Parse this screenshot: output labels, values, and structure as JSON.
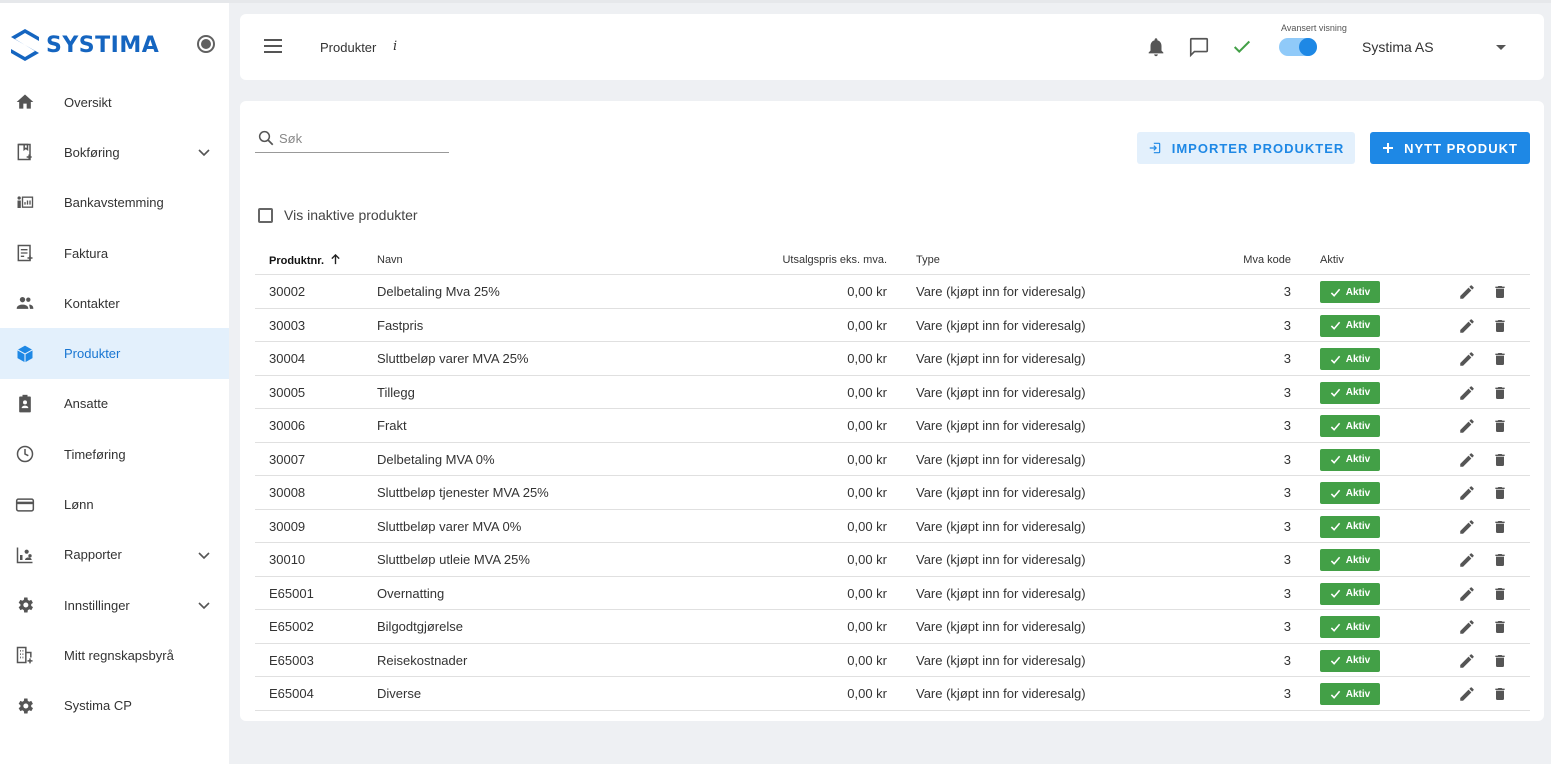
{
  "app": {
    "logo_text": "SYSTIMA"
  },
  "sidebar": {
    "items": [
      {
        "label": "Oversikt",
        "icon": "home-icon"
      },
      {
        "label": "Bokføring",
        "icon": "bookkeeping-icon",
        "expandable": true
      },
      {
        "label": "Bankavstemming",
        "icon": "bank-reconciliation-icon"
      },
      {
        "label": "Faktura",
        "icon": "invoice-icon"
      },
      {
        "label": "Kontakter",
        "icon": "contacts-icon"
      },
      {
        "label": "Produkter",
        "icon": "product-box-icon",
        "active": true
      },
      {
        "label": "Ansatte",
        "icon": "employee-badge-icon"
      },
      {
        "label": "Timeføring",
        "icon": "clock-icon"
      },
      {
        "label": "Lønn",
        "icon": "credit-card-icon"
      },
      {
        "label": "Rapporter",
        "icon": "reports-icon",
        "expandable": true
      },
      {
        "label": "Innstillinger",
        "icon": "settings-gear-icon",
        "expandable": true
      },
      {
        "label": "Mitt regnskapsbyrå",
        "icon": "office-building-icon"
      },
      {
        "label": "Systima CP",
        "icon": "settings-gear-icon"
      }
    ]
  },
  "header": {
    "breadcrumb": "Produkter",
    "info": "i",
    "advanced_view_label": "Avansert visning",
    "advanced_view_on": true,
    "company": "Systima AS"
  },
  "toolbar": {
    "search_placeholder": "Søk",
    "import_label": "IMPORTER PRODUKTER",
    "new_label": "NYTT PRODUKT",
    "show_inactive_label": "Vis inaktive produkter"
  },
  "table": {
    "columns": {
      "nr": "Produktnr.",
      "navn": "Navn",
      "pris": "Utsalgspris eks. mva.",
      "type": "Type",
      "mva": "Mva kode",
      "aktiv": "Aktiv"
    },
    "rows": [
      {
        "nr": "30002",
        "navn": "Delbetaling Mva 25%",
        "pris": "0,00 kr",
        "type": "Vare (kjøpt inn for videresalg)",
        "mva": "3",
        "aktiv": "Aktiv"
      },
      {
        "nr": "30003",
        "navn": "Fastpris",
        "pris": "0,00 kr",
        "type": "Vare (kjøpt inn for videresalg)",
        "mva": "3",
        "aktiv": "Aktiv"
      },
      {
        "nr": "30004",
        "navn": "Sluttbeløp varer MVA 25%",
        "pris": "0,00 kr",
        "type": "Vare (kjøpt inn for videresalg)",
        "mva": "3",
        "aktiv": "Aktiv"
      },
      {
        "nr": "30005",
        "navn": "Tillegg",
        "pris": "0,00 kr",
        "type": "Vare (kjøpt inn for videresalg)",
        "mva": "3",
        "aktiv": "Aktiv"
      },
      {
        "nr": "30006",
        "navn": "Frakt",
        "pris": "0,00 kr",
        "type": "Vare (kjøpt inn for videresalg)",
        "mva": "3",
        "aktiv": "Aktiv"
      },
      {
        "nr": "30007",
        "navn": "Delbetaling MVA 0%",
        "pris": "0,00 kr",
        "type": "Vare (kjøpt inn for videresalg)",
        "mva": "3",
        "aktiv": "Aktiv"
      },
      {
        "nr": "30008",
        "navn": "Sluttbeløp tjenester MVA 25%",
        "pris": "0,00 kr",
        "type": "Vare (kjøpt inn for videresalg)",
        "mva": "3",
        "aktiv": "Aktiv"
      },
      {
        "nr": "30009",
        "navn": "Sluttbeløp varer MVA 0%",
        "pris": "0,00 kr",
        "type": "Vare (kjøpt inn for videresalg)",
        "mva": "3",
        "aktiv": "Aktiv"
      },
      {
        "nr": "30010",
        "navn": "Sluttbeløp utleie MVA 25%",
        "pris": "0,00 kr",
        "type": "Vare (kjøpt inn for videresalg)",
        "mva": "3",
        "aktiv": "Aktiv"
      },
      {
        "nr": "E65001",
        "navn": "Overnatting",
        "pris": "0,00 kr",
        "type": "Vare (kjøpt inn for videresalg)",
        "mva": "3",
        "aktiv": "Aktiv"
      },
      {
        "nr": "E65002",
        "navn": "Bilgodtgjørelse",
        "pris": "0,00 kr",
        "type": "Vare (kjøpt inn for videresalg)",
        "mva": "3",
        "aktiv": "Aktiv"
      },
      {
        "nr": "E65003",
        "navn": "Reisekostnader",
        "pris": "0,00 kr",
        "type": "Vare (kjøpt inn for videresalg)",
        "mva": "3",
        "aktiv": "Aktiv"
      },
      {
        "nr": "E65004",
        "navn": "Diverse",
        "pris": "0,00 kr",
        "type": "Vare (kjøpt inn for videresalg)",
        "mva": "3",
        "aktiv": "Aktiv"
      }
    ]
  },
  "colors": {
    "accent": "#1e88e5",
    "active_bg": "#e3f0fc",
    "status_active": "#43a047",
    "logo": "#1565c0"
  }
}
